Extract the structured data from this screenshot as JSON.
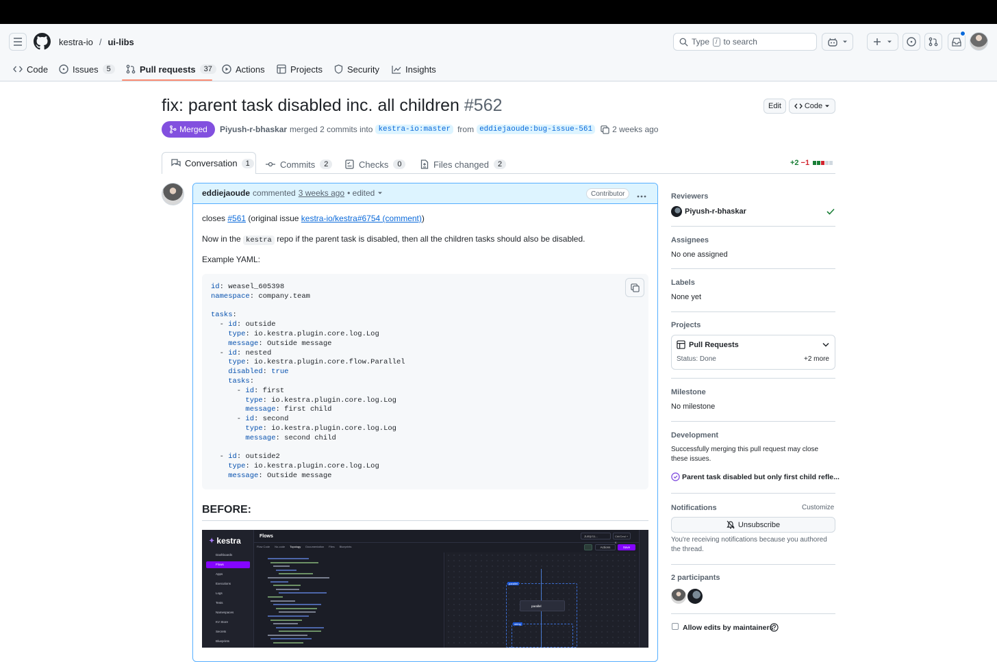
{
  "header": {
    "owner": "kestra-io",
    "separator": "/",
    "repo": "ui-libs",
    "search_text_before": "Type",
    "search_key": "/",
    "search_text_after": "to search"
  },
  "repo_nav": [
    {
      "label": "Code",
      "count": ""
    },
    {
      "label": "Issues",
      "count": "5"
    },
    {
      "label": "Pull requests",
      "count": "37"
    },
    {
      "label": "Actions",
      "count": ""
    },
    {
      "label": "Projects",
      "count": ""
    },
    {
      "label": "Security",
      "count": ""
    },
    {
      "label": "Insights",
      "count": ""
    }
  ],
  "pr": {
    "title": "fix: parent task disabled inc. all children",
    "number": "#562",
    "edit_label": "Edit",
    "code_label": "Code",
    "state": "Merged",
    "author": "Piyush-r-bhaskar",
    "action_text": "merged 2 commits into",
    "base_branch": "kestra-io:master",
    "from_text": "from",
    "head_branch": "eddiejaoude:bug-issue-561",
    "time": "2 weeks ago"
  },
  "tabs": [
    {
      "label": "Conversation",
      "count": "1"
    },
    {
      "label": "Commits",
      "count": "2"
    },
    {
      "label": "Checks",
      "count": "0"
    },
    {
      "label": "Files changed",
      "count": "2"
    }
  ],
  "diffstat": {
    "added": "+2",
    "removed": "−1"
  },
  "comment": {
    "author": "eddiejaoude",
    "verb": "commented",
    "time": "3 weeks ago",
    "edited": "• edited",
    "role": "Contributor",
    "closes_prefix": "closes",
    "closes_link": "#561",
    "original_prefix": "(original issue",
    "original_link": "kestra-io/kestra#6754 (comment)",
    "original_suffix": ")",
    "line2_prefix": "Now in the",
    "line2_code": "kestra",
    "line2_suffix": "repo if the parent task is disabled, then all the children tasks should also be disabled.",
    "example_label": "Example YAML:",
    "before_heading": "BEFORE:"
  },
  "yaml_lines": [
    "id: weasel_605398",
    "namespace: company.team",
    "",
    "tasks:",
    "  - id: outside",
    "    type: io.kestra.plugin.core.log.Log",
    "    message: Outside message",
    "  - id: nested",
    "    type: io.kestra.plugin.core.flow.Parallel",
    "    disabled: true",
    "    tasks:",
    "      - id: first",
    "        type: io.kestra.plugin.core.log.Log",
    "        message: first child",
    "      - id: second",
    "        type: io.kestra.plugin.core.log.Log",
    "        message: second child",
    "",
    "  - id: outside2",
    "    type: io.kestra.plugin.core.log.Log",
    "    message: Outside message"
  ],
  "screenshot": {
    "brand": "kestra",
    "page_title": "Flows",
    "menu": [
      "Dashboards",
      "Flows",
      "Apps",
      "Executions",
      "Logs",
      "Tests",
      "Namespaces",
      "KV Store",
      "Secrets",
      "Blueprints"
    ],
    "tabs": [
      "Flow Code",
      "No-code",
      "Topology",
      "Documentation",
      "Files",
      "Blueprints"
    ],
    "jump": "Jump to...",
    "shortcut": "Ctrl/Cmd + K",
    "actions": "Actions",
    "save": "Save",
    "node1": "parallel",
    "badge1": "parallel",
    "badge2": "string"
  },
  "sidebar": {
    "reviewers_label": "Reviewers",
    "reviewer": "Piyush-r-bhaskar",
    "assignees_label": "Assignees",
    "assignees_value": "No one assigned",
    "labels_label": "Labels",
    "labels_value": "None yet",
    "projects_label": "Projects",
    "project_name": "Pull Requests",
    "project_status": "Status: Done",
    "project_more": "+2 more",
    "milestone_label": "Milestone",
    "milestone_value": "No milestone",
    "development_label": "Development",
    "development_text": "Successfully merging this pull request may close these issues.",
    "linked_issue": "Parent task disabled but only first child refle...",
    "notifications_label": "Notifications",
    "customize": "Customize",
    "unsubscribe": "Unsubscribe",
    "notif_text": "You're receiving notifications because you authored the thread.",
    "participants_label": "2 participants",
    "allow_edits": "Allow edits by maintainers"
  },
  "colors": {
    "merged": "#8250df",
    "link": "#0969da",
    "accent_underline": "#fd8c73"
  }
}
